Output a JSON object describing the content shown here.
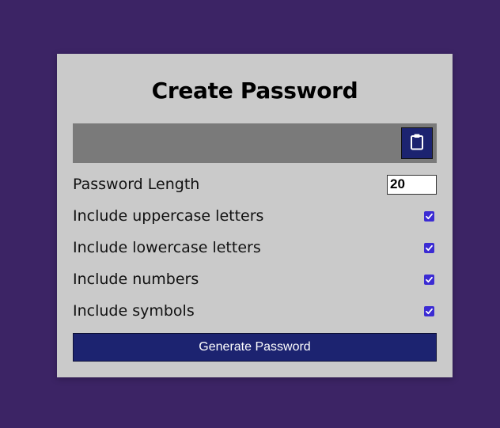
{
  "page": {
    "background_color": "#3c2465"
  },
  "card": {
    "title": "Create Password",
    "result": {
      "value": "",
      "copy_icon": "clipboard-icon"
    },
    "settings": {
      "length": {
        "label": "Password Length",
        "value": "20"
      },
      "uppercase": {
        "label": "Include uppercase letters",
        "checked": true
      },
      "lowercase": {
        "label": "Include lowercase letters",
        "checked": true
      },
      "numbers": {
        "label": "Include numbers",
        "checked": true
      },
      "symbols": {
        "label": "Include symbols",
        "checked": true
      }
    },
    "generate_label": "Generate Password"
  },
  "colors": {
    "card_bg": "#cacaca",
    "result_bg": "#7a7a7a",
    "button_bg": "#1c2370",
    "checkbox_accent": "#3b2bd3"
  }
}
